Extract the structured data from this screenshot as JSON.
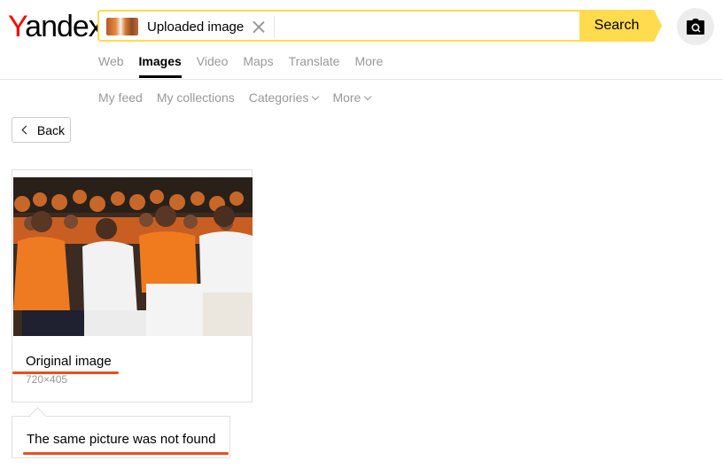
{
  "header": {
    "logo_first_letter": "Y",
    "logo_rest": "andex",
    "chip_text": "Uploaded image",
    "search_button": "Search"
  },
  "services": [
    "Web",
    "Images",
    "Video",
    "Maps",
    "Translate",
    "More"
  ],
  "subnav": {
    "my_feed": "My feed",
    "my_collections": "My collections",
    "categories": "Categories",
    "more": "More"
  },
  "back_label": "Back",
  "original": {
    "title": "Original image",
    "dims": "720×405"
  },
  "not_found_text": "The same picture was not found",
  "colors": {
    "brand_red": "#ff0000",
    "search_yellow": "#ffdb4d",
    "annotation_orange": "#e8501c"
  },
  "icons": {
    "camera": "camera-icon",
    "clear": "close-icon",
    "back": "chevron-left-icon"
  }
}
